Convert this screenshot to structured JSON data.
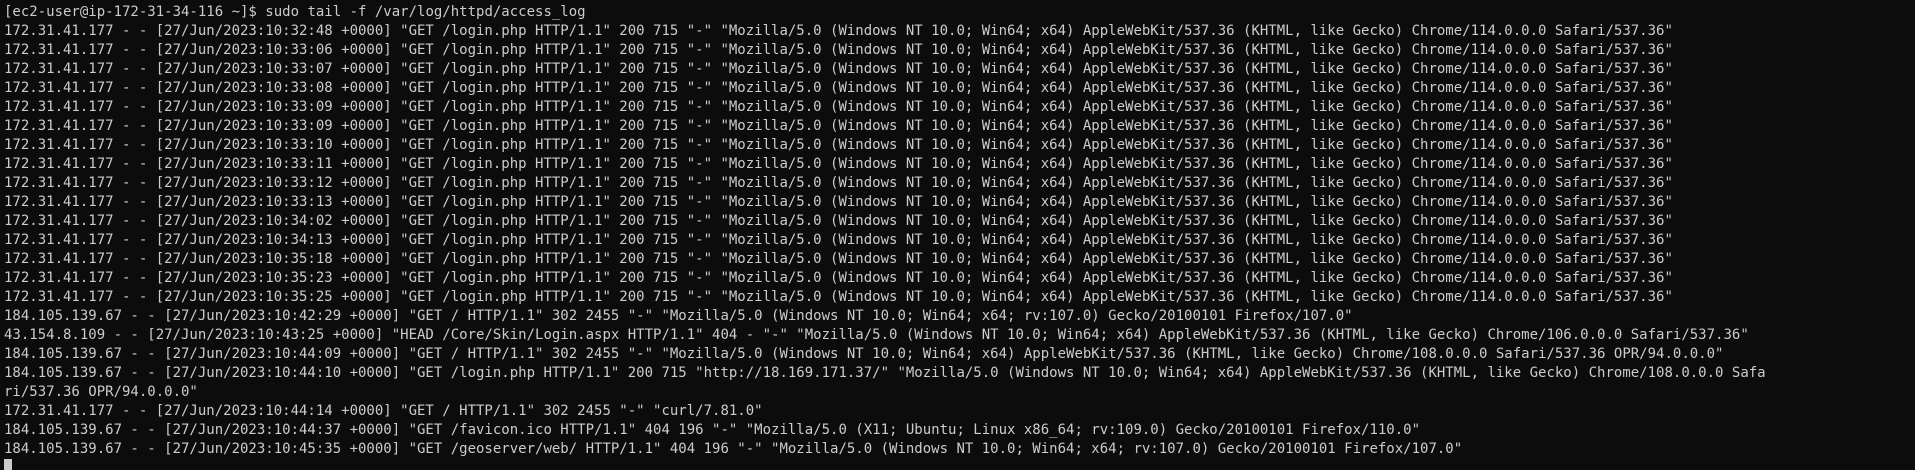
{
  "terminal": {
    "prompt": "[ec2-user@ip-172-31-34-116 ~]$ ",
    "command": "sudo tail -f /var/log/httpd/access_log",
    "lines": [
      "172.31.41.177 - - [27/Jun/2023:10:32:48 +0000] \"GET /login.php HTTP/1.1\" 200 715 \"-\" \"Mozilla/5.0 (Windows NT 10.0; Win64; x64) AppleWebKit/537.36 (KHTML, like Gecko) Chrome/114.0.0.0 Safari/537.36\"",
      "172.31.41.177 - - [27/Jun/2023:10:33:06 +0000] \"GET /login.php HTTP/1.1\" 200 715 \"-\" \"Mozilla/5.0 (Windows NT 10.0; Win64; x64) AppleWebKit/537.36 (KHTML, like Gecko) Chrome/114.0.0.0 Safari/537.36\"",
      "172.31.41.177 - - [27/Jun/2023:10:33:07 +0000] \"GET /login.php HTTP/1.1\" 200 715 \"-\" \"Mozilla/5.0 (Windows NT 10.0; Win64; x64) AppleWebKit/537.36 (KHTML, like Gecko) Chrome/114.0.0.0 Safari/537.36\"",
      "172.31.41.177 - - [27/Jun/2023:10:33:08 +0000] \"GET /login.php HTTP/1.1\" 200 715 \"-\" \"Mozilla/5.0 (Windows NT 10.0; Win64; x64) AppleWebKit/537.36 (KHTML, like Gecko) Chrome/114.0.0.0 Safari/537.36\"",
      "172.31.41.177 - - [27/Jun/2023:10:33:09 +0000] \"GET /login.php HTTP/1.1\" 200 715 \"-\" \"Mozilla/5.0 (Windows NT 10.0; Win64; x64) AppleWebKit/537.36 (KHTML, like Gecko) Chrome/114.0.0.0 Safari/537.36\"",
      "172.31.41.177 - - [27/Jun/2023:10:33:09 +0000] \"GET /login.php HTTP/1.1\" 200 715 \"-\" \"Mozilla/5.0 (Windows NT 10.0; Win64; x64) AppleWebKit/537.36 (KHTML, like Gecko) Chrome/114.0.0.0 Safari/537.36\"",
      "172.31.41.177 - - [27/Jun/2023:10:33:10 +0000] \"GET /login.php HTTP/1.1\" 200 715 \"-\" \"Mozilla/5.0 (Windows NT 10.0; Win64; x64) AppleWebKit/537.36 (KHTML, like Gecko) Chrome/114.0.0.0 Safari/537.36\"",
      "172.31.41.177 - - [27/Jun/2023:10:33:11 +0000] \"GET /login.php HTTP/1.1\" 200 715 \"-\" \"Mozilla/5.0 (Windows NT 10.0; Win64; x64) AppleWebKit/537.36 (KHTML, like Gecko) Chrome/114.0.0.0 Safari/537.36\"",
      "172.31.41.177 - - [27/Jun/2023:10:33:12 +0000] \"GET /login.php HTTP/1.1\" 200 715 \"-\" \"Mozilla/5.0 (Windows NT 10.0; Win64; x64) AppleWebKit/537.36 (KHTML, like Gecko) Chrome/114.0.0.0 Safari/537.36\"",
      "172.31.41.177 - - [27/Jun/2023:10:33:13 +0000] \"GET /login.php HTTP/1.1\" 200 715 \"-\" \"Mozilla/5.0 (Windows NT 10.0; Win64; x64) AppleWebKit/537.36 (KHTML, like Gecko) Chrome/114.0.0.0 Safari/537.36\"",
      "172.31.41.177 - - [27/Jun/2023:10:34:02 +0000] \"GET /login.php HTTP/1.1\" 200 715 \"-\" \"Mozilla/5.0 (Windows NT 10.0; Win64; x64) AppleWebKit/537.36 (KHTML, like Gecko) Chrome/114.0.0.0 Safari/537.36\"",
      "172.31.41.177 - - [27/Jun/2023:10:34:13 +0000] \"GET /login.php HTTP/1.1\" 200 715 \"-\" \"Mozilla/5.0 (Windows NT 10.0; Win64; x64) AppleWebKit/537.36 (KHTML, like Gecko) Chrome/114.0.0.0 Safari/537.36\"",
      "172.31.41.177 - - [27/Jun/2023:10:35:18 +0000] \"GET /login.php HTTP/1.1\" 200 715 \"-\" \"Mozilla/5.0 (Windows NT 10.0; Win64; x64) AppleWebKit/537.36 (KHTML, like Gecko) Chrome/114.0.0.0 Safari/537.36\"",
      "172.31.41.177 - - [27/Jun/2023:10:35:23 +0000] \"GET /login.php HTTP/1.1\" 200 715 \"-\" \"Mozilla/5.0 (Windows NT 10.0; Win64; x64) AppleWebKit/537.36 (KHTML, like Gecko) Chrome/114.0.0.0 Safari/537.36\"",
      "172.31.41.177 - - [27/Jun/2023:10:35:25 +0000] \"GET /login.php HTTP/1.1\" 200 715 \"-\" \"Mozilla/5.0 (Windows NT 10.0; Win64; x64) AppleWebKit/537.36 (KHTML, like Gecko) Chrome/114.0.0.0 Safari/537.36\"",
      "184.105.139.67 - - [27/Jun/2023:10:42:29 +0000] \"GET / HTTP/1.1\" 302 2455 \"-\" \"Mozilla/5.0 (Windows NT 10.0; Win64; x64; rv:107.0) Gecko/20100101 Firefox/107.0\"",
      "43.154.8.109 - - [27/Jun/2023:10:43:25 +0000] \"HEAD /Core/Skin/Login.aspx HTTP/1.1\" 404 - \"-\" \"Mozilla/5.0 (Windows NT 10.0; Win64; x64) AppleWebKit/537.36 (KHTML, like Gecko) Chrome/106.0.0.0 Safari/537.36\"",
      "184.105.139.67 - - [27/Jun/2023:10:44:09 +0000] \"GET / HTTP/1.1\" 302 2455 \"-\" \"Mozilla/5.0 (Windows NT 10.0; Win64; x64) AppleWebKit/537.36 (KHTML, like Gecko) Chrome/108.0.0.0 Safari/537.36 OPR/94.0.0.0\"",
      "184.105.139.67 - - [27/Jun/2023:10:44:10 +0000] \"GET /login.php HTTP/1.1\" 200 715 \"http://18.169.171.37/\" \"Mozilla/5.0 (Windows NT 10.0; Win64; x64) AppleWebKit/537.36 (KHTML, like Gecko) Chrome/108.0.0.0 Safa",
      "ri/537.36 OPR/94.0.0.0\"",
      "172.31.41.177 - - [27/Jun/2023:10:44:14 +0000] \"GET / HTTP/1.1\" 302 2455 \"-\" \"curl/7.81.0\"",
      "184.105.139.67 - - [27/Jun/2023:10:44:37 +0000] \"GET /favicon.ico HTTP/1.1\" 404 196 \"-\" \"Mozilla/5.0 (X11; Ubuntu; Linux x86_64; rv:109.0) Gecko/20100101 Firefox/110.0\"",
      "184.105.139.67 - - [27/Jun/2023:10:45:35 +0000] \"GET /geoserver/web/ HTTP/1.1\" 404 196 \"-\" \"Mozilla/5.0 (Windows NT 10.0; Win64; x64; rv:107.0) Gecko/20100101 Firefox/107.0\""
    ]
  },
  "colors": {
    "background": "#0c0c0c",
    "foreground": "#cccccc"
  }
}
